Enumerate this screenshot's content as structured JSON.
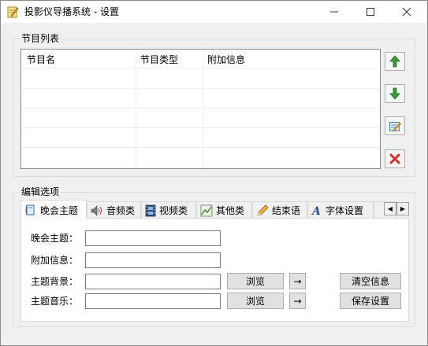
{
  "window": {
    "title": "投影仪导播系统 - 设置",
    "minimize_glyph": "—",
    "maximize_glyph": "☐",
    "close_glyph": "✕"
  },
  "program_list": {
    "group_label": "节目列表",
    "columns": [
      "节目名",
      "节目类型",
      "附加信息"
    ],
    "rows": [],
    "side_buttons": [
      {
        "name": "move-up-button",
        "icon": "green-up-arrow-icon"
      },
      {
        "name": "move-down-button",
        "icon": "green-down-arrow-icon"
      },
      {
        "name": "edit-button",
        "icon": "edit-pencil-icon"
      },
      {
        "name": "delete-button",
        "icon": "red-x-icon"
      }
    ]
  },
  "edit_options": {
    "group_label": "编辑选项",
    "tabs": [
      {
        "label": "晚会主题",
        "icon": "book-icon",
        "active": true
      },
      {
        "label": "音频类",
        "icon": "speaker-icon",
        "active": false
      },
      {
        "label": "视频类",
        "icon": "film-icon",
        "active": false
      },
      {
        "label": "其他类",
        "icon": "chart-icon",
        "active": false
      },
      {
        "label": "结束语",
        "icon": "pencil-icon",
        "active": false
      },
      {
        "label": "字体设置",
        "icon": "font-icon",
        "active": false
      }
    ],
    "tab_scroll_left": "◀",
    "tab_scroll_right": "▶",
    "fields": {
      "theme_label": "晚会主题：",
      "theme_value": "",
      "extra_label": "附加信息：",
      "extra_value": "",
      "background_label": "主题背景：",
      "background_value": "",
      "music_label": "主题音乐：",
      "music_value": ""
    },
    "browse_label": "浏览",
    "arrow_label": "→",
    "clear_button": "清空信息",
    "save_button": "保存设置"
  },
  "colors": {
    "accent_green": "#3c9a3c",
    "delete_red": "#d9302e",
    "frame_border": "#d5dfe5"
  }
}
